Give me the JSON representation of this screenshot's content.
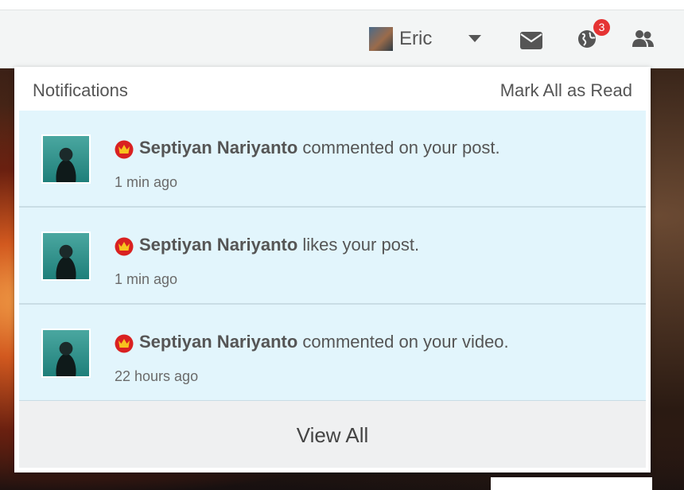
{
  "header": {
    "user_name": "Eric",
    "notification_count": "3",
    "icons": [
      "caret-down-icon",
      "mail-icon",
      "globe-icon",
      "people-icon"
    ]
  },
  "notifications_panel": {
    "title": "Notifications",
    "mark_all_read": "Mark All as Read",
    "items": [
      {
        "user": "Septiyan Nariyanto",
        "action": "commented on your post.",
        "time": "1 min ago"
      },
      {
        "user": "Septiyan Nariyanto",
        "action": "likes your post.",
        "time": "1 min ago"
      },
      {
        "user": "Septiyan Nariyanto",
        "action": "commented on your video.",
        "time": "22 hours ago"
      }
    ],
    "view_all": "View All"
  },
  "colors": {
    "unread_bg": "#e2f5fc",
    "badge": "#e53333",
    "crown_badge": "#d92121"
  }
}
